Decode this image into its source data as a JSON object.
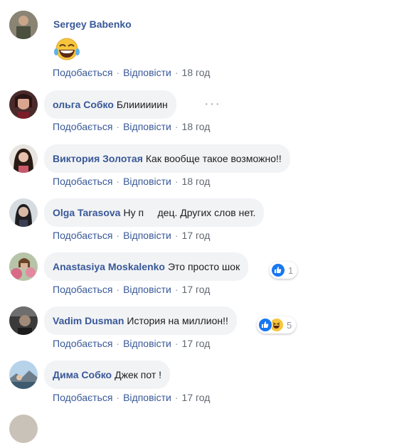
{
  "actions": {
    "like": "Подобається",
    "reply": "Відповісти",
    "sep": "·"
  },
  "comments": [
    {
      "author": "Sergey Babenko",
      "text": "",
      "emoji": "grinning-sweat-emoji",
      "time": "18 год"
    },
    {
      "author": "ольга Собко",
      "text": "Блиииииин",
      "time": "18 год"
    },
    {
      "author": "Виктория Золотая",
      "text": "Как вообще такое возможно!!",
      "time": "18 год"
    },
    {
      "author": "Olga Tarasova",
      "text": "Ну п     дец. Других слов нет.",
      "time": "17 год"
    },
    {
      "author": "Anastasiya Moskalenko",
      "text": "Это просто шок",
      "time": "17 год",
      "reactions": "1"
    },
    {
      "author": "Vadim Dusman",
      "text": "История на миллион!!",
      "time": "17 год",
      "reactions": "5"
    },
    {
      "author": "Дима Собко",
      "text": "Джек пот !",
      "time": "17 год"
    }
  ],
  "colors": {
    "link": "#385898",
    "bubble": "#f2f3f5",
    "meta": "#606770",
    "like": "#1877f2",
    "haha": "#f7c53d"
  }
}
